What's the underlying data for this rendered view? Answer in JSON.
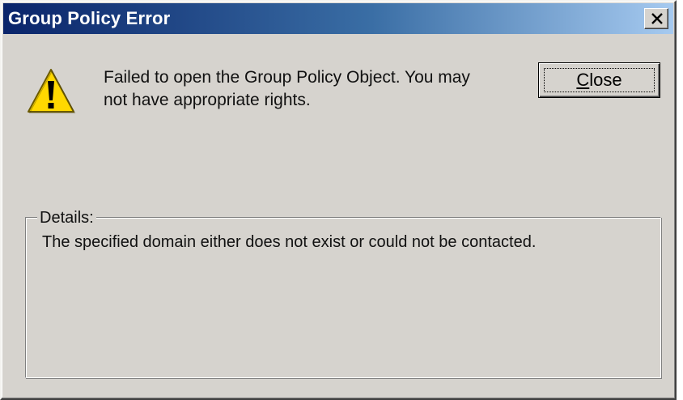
{
  "window": {
    "title": "Group Policy Error",
    "close_glyph": "×"
  },
  "icons": {
    "warning": "warning-triangle-icon",
    "close": "close-icon"
  },
  "message": {
    "line1": "Failed to open the Group Policy Object.  You may",
    "line2": "not have appropriate rights."
  },
  "buttons": {
    "close_mnemonic": "C",
    "close_rest": "lose"
  },
  "details": {
    "label": "Details:",
    "text": "The specified domain either does not exist or could not be contacted."
  },
  "colors": {
    "face": "#d6d3ce",
    "title_start": "#0a246a",
    "title_end": "#a6caf0",
    "warning_yellow": "#ffd800"
  }
}
